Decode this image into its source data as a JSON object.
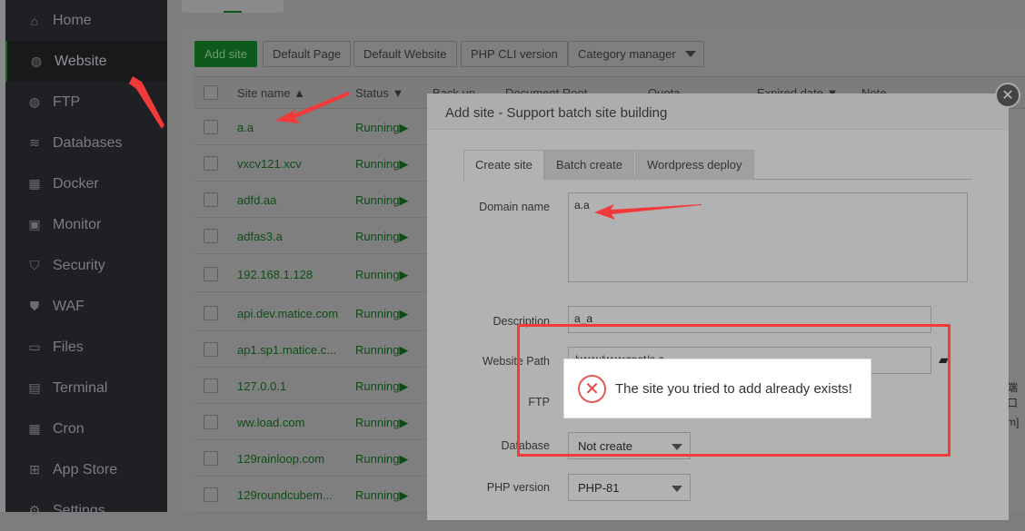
{
  "sidebar": {
    "items": [
      {
        "label": "Home",
        "icon": "home-icon",
        "glyph": "⌂"
      },
      {
        "label": "Website",
        "icon": "globe-icon",
        "glyph": "◍",
        "active": true
      },
      {
        "label": "FTP",
        "icon": "ftp-icon",
        "glyph": "◍"
      },
      {
        "label": "Databases",
        "icon": "database-icon",
        "glyph": "≋"
      },
      {
        "label": "Docker",
        "icon": "docker-icon",
        "glyph": "▦"
      },
      {
        "label": "Monitor",
        "icon": "monitor-icon",
        "glyph": "▣"
      },
      {
        "label": "Security",
        "icon": "shield-icon",
        "glyph": "⛉"
      },
      {
        "label": "WAF",
        "icon": "waf-icon",
        "glyph": "⛊"
      },
      {
        "label": "Files",
        "icon": "folder-icon",
        "glyph": "▭"
      },
      {
        "label": "Terminal",
        "icon": "terminal-icon",
        "glyph": "▤"
      },
      {
        "label": "Cron",
        "icon": "calendar-icon",
        "glyph": "▦"
      },
      {
        "label": "App Store",
        "icon": "apps-icon",
        "glyph": "⊞"
      },
      {
        "label": "Settings",
        "icon": "gear-icon",
        "glyph": "⚙"
      }
    ]
  },
  "toolbar": {
    "add_site": "Add site",
    "default_page": "Default Page",
    "default_website": "Default Website",
    "php_cli": "PHP CLI version",
    "category": "Category manager"
  },
  "table": {
    "headers": [
      "Site name ▲",
      "Status ▼",
      "Back up",
      "Document Root",
      "Quota",
      "Expired date ▼",
      "Note"
    ],
    "rows": [
      {
        "name": "a.a",
        "status": "Running▶"
      },
      {
        "name": "vxcv121.xcv",
        "status": "Running▶"
      },
      {
        "name": "adfd.aa",
        "status": "Running▶"
      },
      {
        "name": "adfas3.a",
        "status": "Running▶"
      },
      {
        "name": "192.168.1.128",
        "status": "Running▶"
      },
      {
        "name": "api.dev.matice.com",
        "status": "Running▶"
      },
      {
        "name": "ap1.sp1.matice.c...",
        "status": "Running▶"
      },
      {
        "name": "127.0.0.1",
        "status": "Running▶"
      },
      {
        "name": "ww.load.com",
        "status": "Running▶"
      },
      {
        "name": "129rainloop.com",
        "status": "Running▶"
      },
      {
        "name": "129roundcubem...",
        "status": "Running▶"
      }
    ],
    "fragments": [
      "端口",
      "m]"
    ]
  },
  "modal": {
    "title": "Add site - Support batch site building",
    "close": "✕",
    "tabs": [
      "Create site",
      "Batch create",
      "Wordpress deploy"
    ],
    "domain_label": "Domain name",
    "domain_value": "a.a",
    "desc_label": "Description",
    "desc_value": "a_a",
    "path_label": "Website Path",
    "path_value": "/www/wwwroot/a.a",
    "ftp_label": "FTP",
    "db_label": "Database",
    "db_value": "Not create",
    "php_label": "PHP version",
    "php_value": "PHP-81"
  },
  "toast": {
    "message": "The site you tried to add already exists!"
  },
  "colors": {
    "accent": "#20a53a",
    "error": "#e04848",
    "annotation": "#f23a3a"
  }
}
